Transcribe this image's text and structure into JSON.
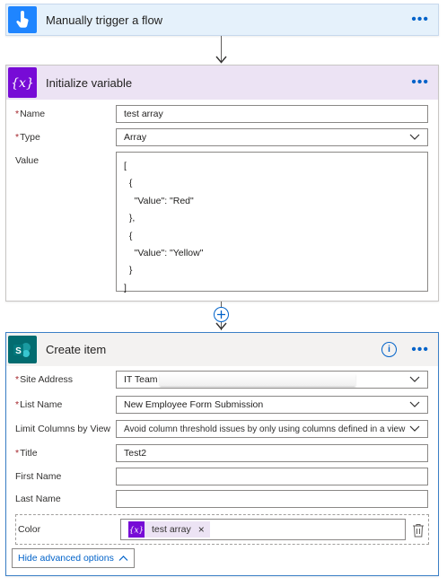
{
  "trigger": {
    "title": "Manually trigger a flow",
    "menu": "•••"
  },
  "init_var": {
    "title": "Initialize variable",
    "menu": "•••",
    "name_label": "Name",
    "name_value": "test array",
    "type_label": "Type",
    "type_value": "Array",
    "value_label": "Value",
    "value_lines": [
      "[",
      "  {",
      "    \"Value\": \"Red\"",
      "  },",
      "  {",
      "    \"Value\": \"Yellow\"",
      "  }",
      "]"
    ]
  },
  "create_item": {
    "title": "Create item",
    "menu": "•••",
    "info_icon": "i",
    "site_label": "Site Address",
    "site_value": "IT Team -",
    "list_label": "List Name",
    "list_value": "New Employee Form Submission",
    "limit_label": "Limit Columns by View",
    "limit_value": "Avoid column threshold issues by only using columns defined in a view",
    "title_label": "Title",
    "title_value": "Test2",
    "first_label": "First Name",
    "first_value": "",
    "last_label": "Last Name",
    "last_value": "",
    "color_label": "Color",
    "token_label": "test array",
    "token_remove": "×",
    "toggle_label": "Hide advanced options"
  },
  "colors": {
    "trigger_bg": "#e5f1fb",
    "trigger_icon": "#1f85ff",
    "var_bg": "#ece3f4",
    "var_icon": "#770bd6",
    "sp_icon": "#036c70",
    "link": "#0062c9"
  }
}
